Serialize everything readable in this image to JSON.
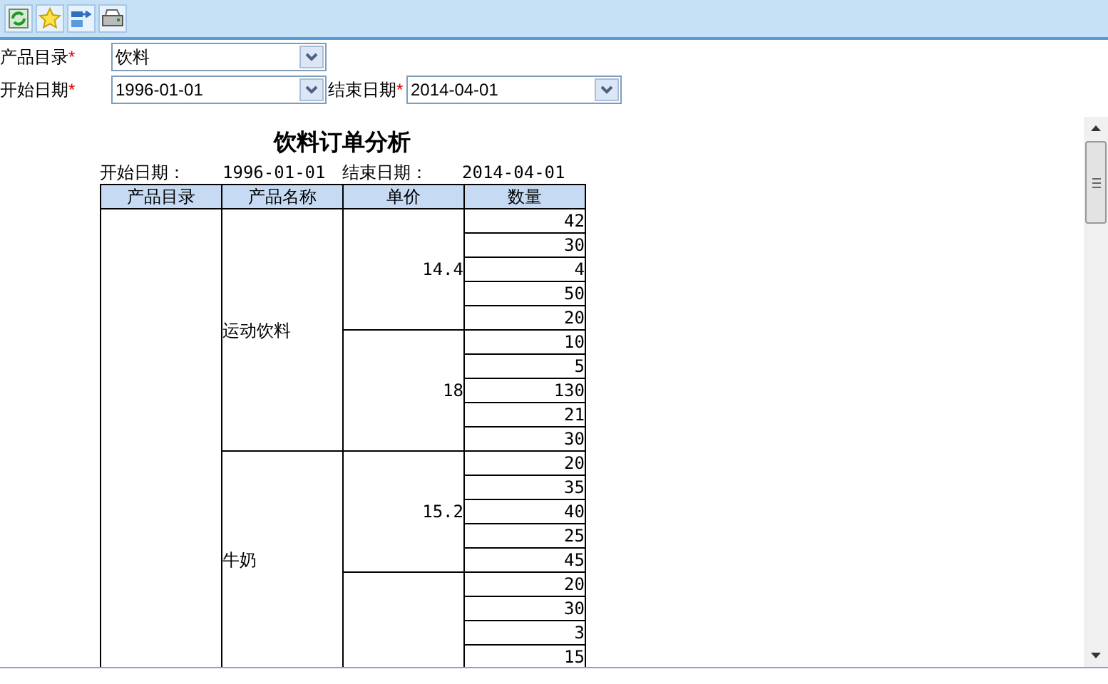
{
  "form": {
    "fields": [
      {
        "label": "产品目录",
        "value": "饮料",
        "required_mark": "*"
      },
      {
        "label": "开始日期",
        "value": "1996-01-01",
        "required_mark": "*"
      },
      {
        "label": "结束日期",
        "value": "2014-04-01",
        "required_mark": "*"
      }
    ]
  },
  "report": {
    "title": "饮料订单分析",
    "start_label": "开始日期：",
    "start_value": "1996-01-01",
    "end_label": "结束日期：",
    "end_value": "2014-04-01",
    "columns": [
      "产品目录",
      "产品名称",
      "单价",
      "数量"
    ],
    "products": [
      {
        "name": "运动饮料",
        "groups": [
          {
            "price": "14.4",
            "quantities": [
              "42",
              "30",
              "4",
              "50",
              "20"
            ]
          },
          {
            "price": "18",
            "quantities": [
              "10",
              "5",
              "130",
              "21",
              "30"
            ]
          }
        ]
      },
      {
        "name": "牛奶",
        "groups": [
          {
            "price": "15.2",
            "quantities": [
              "20",
              "35",
              "40",
              "25",
              "45"
            ]
          },
          {
            "quantities": [
              "20",
              "30",
              "3",
              "15"
            ]
          }
        ]
      }
    ]
  }
}
